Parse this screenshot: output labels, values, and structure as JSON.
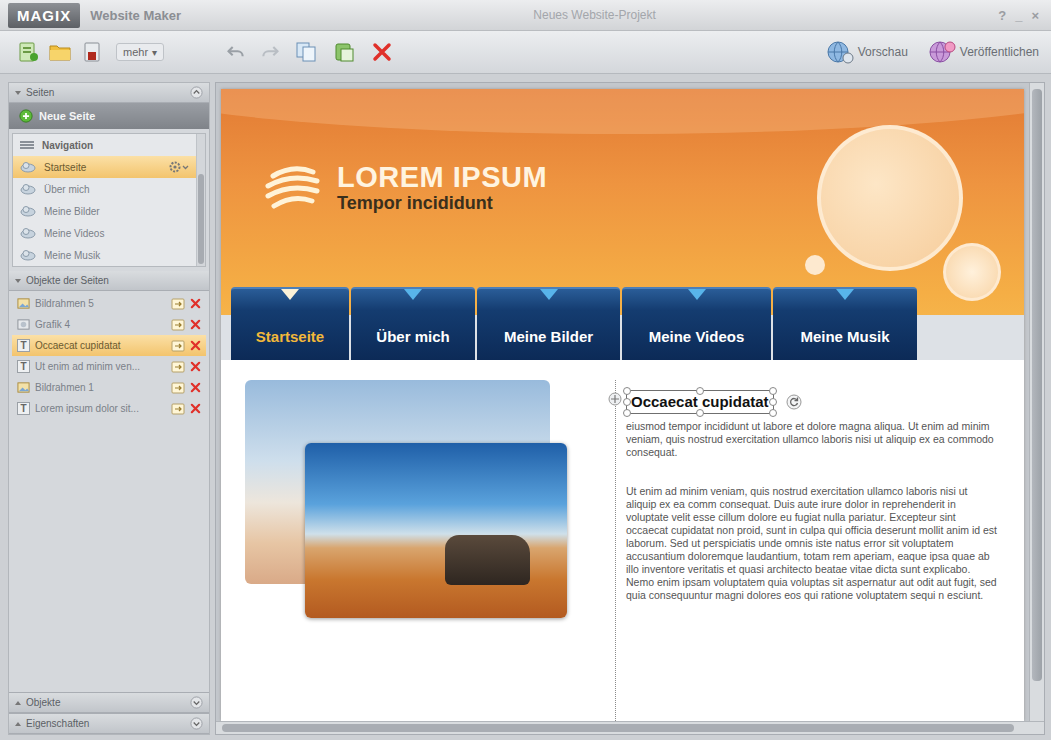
{
  "window": {
    "logo": "MAGIX",
    "app": "Website Maker",
    "title": "Neues Website-Projekt",
    "controls": [
      "?",
      "_",
      "×"
    ]
  },
  "toolbar": {
    "more": "mehr",
    "more_arrow": "▾",
    "preview": "Vorschau",
    "publish": "Veröffentlichen"
  },
  "sidebar": {
    "pages_section": {
      "label": "Seiten",
      "expanded": true
    },
    "new_page": "Neue Seite",
    "nav_header": "Navigation",
    "pages": [
      {
        "label": "Startseite",
        "selected": true
      },
      {
        "label": "Über mich",
        "selected": false
      },
      {
        "label": "Meine Bilder",
        "selected": false
      },
      {
        "label": "Meine Videos",
        "selected": false
      },
      {
        "label": "Meine Musik",
        "selected": false
      }
    ],
    "objects_section": {
      "label": "Objekte der Seiten",
      "expanded": true
    },
    "text_icon": "T",
    "objects": [
      {
        "label": "Bildrahmen 5",
        "kind": "image",
        "selected": false
      },
      {
        "label": "Grafik 4",
        "kind": "graphic",
        "selected": false
      },
      {
        "label": "Occaecat cupidatat",
        "kind": "text",
        "selected": true
      },
      {
        "label": "Ut enim ad minim ven...",
        "kind": "text",
        "selected": false
      },
      {
        "label": "Bildrahmen 1",
        "kind": "image",
        "selected": false
      },
      {
        "label": "Lorem ipsum dolor sit...",
        "kind": "text",
        "selected": false
      }
    ],
    "bottom_sections": [
      {
        "label": "Objekte",
        "expanded": false
      },
      {
        "label": "Eigenschaften",
        "expanded": false
      }
    ]
  },
  "site": {
    "title": "LOREM IPSUM",
    "subtitle": "Tempor incididunt",
    "nav": [
      {
        "label": "Startseite",
        "selected": true
      },
      {
        "label": "Über mich",
        "selected": false
      },
      {
        "label": "Meine Bilder",
        "selected": false
      },
      {
        "label": "Meine Videos",
        "selected": false
      },
      {
        "label": "Meine Musik",
        "selected": false
      }
    ],
    "heading": "Occaecat cupidatat",
    "heading_selected": true,
    "paragraphs": [
      "eiusmod tempor incididunt ut labore  et dolore magna aliqua. Ut enim ad minim veniam, quis nostrud exercitation ullamco laboris nisi ut aliquip ex ea commodo consequat.",
      "Ut enim ad minim veniam, quis nostrud exercitation ullamco laboris nisi ut aliquip ex ea comm consequat. Duis aute irure dolor in reprehenderit in voluptate velit esse cillum dolore eu fugiat nulla pariatur. Excepteur sint occaecat cupidatat non proid, sunt in culpa qui officia deserunt mollit anim id est laborum. Sed ut perspiciatis unde omnis iste natus error sit voluptatem accusantium doloremque laudantium, totam rem aperiam, eaque ipsa quae ab illo inventore veritatis et quasi architecto beatae vitae dicta sunt explicabo. Nemo enim ipsam  voluptatem quia voluptas sit aspernatur aut odit aut fugit, sed quia consequuntur magni dolores eos qui ratione voluptatem sequi n esciunt."
    ]
  }
}
